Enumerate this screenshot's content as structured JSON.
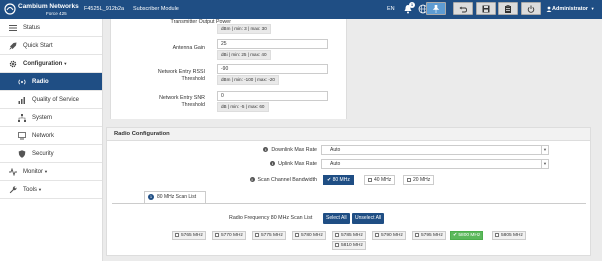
{
  "header": {
    "brand": "Cambium Networks",
    "model": "Force 425",
    "device_name": "F4525L_912b2a",
    "module": "Subscriber Module",
    "language": "EN",
    "notification_count": "1",
    "user": "Administrator"
  },
  "sidebar": {
    "items": [
      {
        "label": "Status"
      },
      {
        "label": "Quick Start"
      },
      {
        "label": "Configuration"
      },
      {
        "label": "Radio"
      },
      {
        "label": "Quality of Service"
      },
      {
        "label": "System"
      },
      {
        "label": "Network"
      },
      {
        "label": "Security"
      },
      {
        "label": "Monitor"
      },
      {
        "label": "Tools"
      }
    ]
  },
  "top_form": {
    "tx_power_label": "Transmitter Output Power",
    "tx_power_hint": "dBm | min: 3 | max: 30",
    "antenna_gain_label": "Antenna Gain",
    "antenna_gain_value": "25",
    "antenna_gain_hint": "dBi | min: 25 | max: 40",
    "rssi_label_1": "Network Entry RSSI",
    "rssi_label_2": "Threshold",
    "rssi_value": "-90",
    "rssi_hint": "dBm | min: -100 | max: -20",
    "snr_label_1": "Network Entry SNR",
    "snr_label_2": "Threshold",
    "snr_value": "0",
    "snr_hint": "dB | min: -5 | max: 60"
  },
  "radio_config": {
    "title": "Radio Configuration",
    "downlink_label": "Downlink Max Rate",
    "downlink_value": "Auto",
    "uplink_label": "Uplink Max Rate",
    "uplink_value": "Auto",
    "scan_bw_label": "Scan Channel Bandwidth",
    "bw_options": [
      "80 MHz",
      "40 MHz",
      "20 MHz"
    ],
    "bw_selected": "80 MHz",
    "tab_number": "1",
    "tab_label": "80 MHz Scan List",
    "scan_list_label": "Radio Frequency 80 MHz Scan List",
    "select_all": "Select All",
    "unselect_all": "Unselect All",
    "frequencies": [
      "5765 MHz",
      "5770 MHz",
      "5775 MHz",
      "5780 MHz",
      "5785 MHz",
      "5790 MHz",
      "5795 MHz",
      "5800 MHz",
      "5805 MHz",
      "5810 MHz"
    ],
    "frequency_selected": "5800 MHz"
  },
  "colors": {
    "header_bg": "#1f4e84",
    "active_item": "#1f4e84",
    "selected_freq": "#5cb85c"
  }
}
